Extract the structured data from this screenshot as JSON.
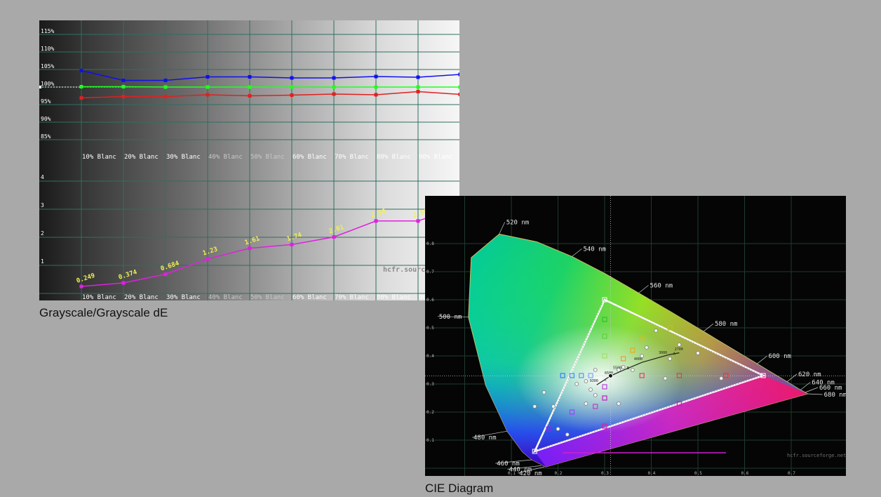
{
  "captions": {
    "grayscale": "Grayscale/Grayscale dE",
    "cie": "CIE Diagram"
  },
  "chart_data": [
    {
      "type": "line",
      "x_categories": [
        "10% Blanc",
        "20% Blanc",
        "30% Blanc",
        "40% Blanc",
        "50% Blanc",
        "60% Blanc",
        "70% Blanc",
        "80% Blanc",
        "90% Blanc",
        "100% Blanc"
      ],
      "yticks": [
        "115%",
        "110%",
        "105%",
        "100%",
        "95%",
        "90%",
        "85%"
      ],
      "ylim": [
        83,
        117
      ],
      "colors": {
        "red": "#e02020",
        "green": "#20ff20",
        "blue": "#1010ee",
        "grid": "#2f6f60"
      },
      "series": [
        {
          "color_key": "blue",
          "values": [
            104.7,
            101.9,
            101.9,
            102.9,
            102.9,
            102.6,
            102.6,
            103.0,
            102.8,
            103.6
          ]
        },
        {
          "color_key": "green",
          "values": [
            100.1,
            100.1,
            100.0,
            100.0,
            100.0,
            100.0,
            100.0,
            100.0,
            100.0,
            100.0
          ]
        },
        {
          "color_key": "red",
          "values": [
            96.9,
            97.3,
            97.3,
            97.8,
            97.5,
            97.7,
            98.0,
            97.8,
            98.7,
            97.9
          ]
        }
      ],
      "watermark": "hcfr.sourceforge.net"
    },
    {
      "type": "line",
      "x_categories": [
        "10% Blanc",
        "20% Blanc",
        "30% Blanc",
        "40% Blanc",
        "50% Blanc",
        "60% Blanc",
        "70% Blanc",
        "80% Blanc",
        "90% Blanc",
        "100% Blanc"
      ],
      "yticks": [
        "4",
        "3",
        "2",
        "1"
      ],
      "ylim": [
        0,
        4.3
      ],
      "color": "#e020e0",
      "label_color": "#f0f050",
      "values": [
        0.249,
        0.374,
        0.684,
        1.23,
        1.61,
        1.74,
        2.01,
        2.58,
        2.58,
        3.1
      ],
      "data_labels": [
        "0.249",
        "0.374",
        "0.684",
        "1.23",
        "1.61",
        "1.74",
        "2.01",
        "2.58",
        "2.58",
        ""
      ]
    },
    {
      "type": "scatter",
      "title": "CIE Diagram",
      "xticks": [
        "0.1",
        "0.2",
        "0.3",
        "0.4",
        "0.5",
        "0.6",
        "0.7"
      ],
      "yticks": [
        "0.8",
        "0.7",
        "0.6",
        "0.5",
        "0.4",
        "0.3",
        "0.2",
        "0.1"
      ],
      "xlim": [
        0,
        0.75
      ],
      "ylim": [
        0,
        0.85
      ],
      "wavelength_labels": [
        {
          "text": "520 nm",
          "x": 0.074,
          "y": 0.834
        },
        {
          "text": "540 nm",
          "x": 0.23,
          "y": 0.754
        },
        {
          "text": "560 nm",
          "x": 0.373,
          "y": 0.624
        },
        {
          "text": "580 nm",
          "x": 0.512,
          "y": 0.487
        },
        {
          "text": "600 nm",
          "x": 0.627,
          "y": 0.372
        },
        {
          "text": "620 nm",
          "x": 0.691,
          "y": 0.308
        },
        {
          "text": "640 nm",
          "x": 0.72,
          "y": 0.279
        },
        {
          "text": "660 nm",
          "x": 0.73,
          "y": 0.27
        },
        {
          "text": "680 nm",
          "x": 0.734,
          "y": 0.265
        },
        {
          "text": "500 nm",
          "x": 0.008,
          "y": 0.538
        },
        {
          "text": "480 nm",
          "x": 0.091,
          "y": 0.132
        },
        {
          "text": "460 nm",
          "x": 0.144,
          "y": 0.03
        },
        {
          "text": "440 nm",
          "x": 0.164,
          "y": 0.009
        },
        {
          "text": "420 nm",
          "x": 0.171,
          "y": 0.005
        }
      ],
      "cct_labels": [
        "9300",
        "6500",
        "5500",
        "4000",
        "3000",
        "2700",
        "B",
        "A",
        "C"
      ],
      "gamut_reference": [
        [
          0.64,
          0.33
        ],
        [
          0.3,
          0.6
        ],
        [
          0.15,
          0.06
        ]
      ],
      "gamut_measured": [
        [
          0.639,
          0.33
        ],
        [
          0.298,
          0.597
        ],
        [
          0.153,
          0.063
        ]
      ],
      "watermark": "hcfr.sourceforge.net"
    }
  ]
}
